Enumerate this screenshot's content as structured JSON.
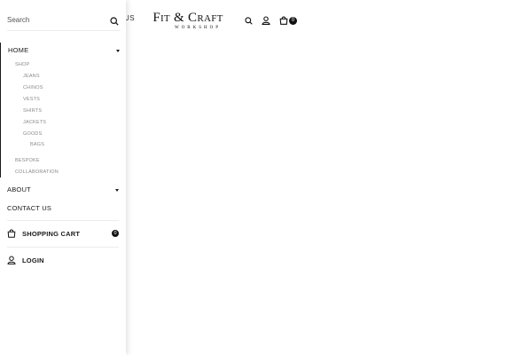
{
  "header": {
    "behind_text": "US",
    "logo_main": "Fit & Craft",
    "logo_sub": "WORKSHOP",
    "cart_count": "0"
  },
  "drawer": {
    "search": {
      "placeholder": "Search",
      "value": ""
    },
    "menu": {
      "home": "HOME",
      "shop": "SHOP",
      "shop_items": [
        "JEANS",
        "CHINOS",
        "VESTS",
        "SHIRTS",
        "JACKETS",
        "GOODS"
      ],
      "bags": "BAGS",
      "bespoke": "BESPOKE",
      "collaboration": "COLLABORATION",
      "about": "ABOUT",
      "contact": "CONTACT US"
    },
    "cart": {
      "label": "SHOPPING CART",
      "count": "0"
    },
    "login": {
      "label": "LOGIN"
    }
  },
  "icons": [
    "search-icon",
    "user-icon",
    "bag-icon",
    "chevron-down-icon"
  ]
}
